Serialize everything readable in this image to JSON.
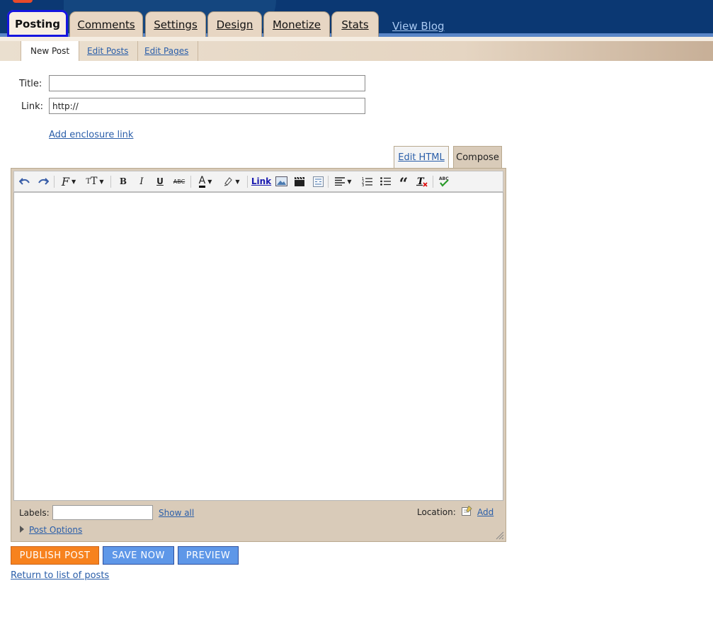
{
  "header": {
    "tabs": [
      {
        "label": "Posting",
        "active": true
      },
      {
        "label": "Comments"
      },
      {
        "label": "Settings"
      },
      {
        "label": "Design"
      },
      {
        "label": "Monetize"
      },
      {
        "label": "Stats"
      }
    ],
    "view_blog": "View Blog",
    "colors": {
      "header_bg": "#0b3873",
      "tab_bg": "#e7d6c3",
      "active_outline": "#1515e0"
    }
  },
  "subnav": {
    "items": [
      "New Post",
      "Edit Posts",
      "Edit Pages"
    ]
  },
  "form": {
    "title_label": "Title:",
    "title_value": "",
    "link_label": "Link:",
    "link_value": "http://",
    "enclosure_link": "Add enclosure link"
  },
  "editor": {
    "mode_tabs": {
      "edit_html": "Edit HTML",
      "compose": "Compose",
      "active": "Compose"
    },
    "toolbar": {
      "link_label": "Link",
      "icons": [
        "undo-icon",
        "redo-icon",
        "font-family-icon",
        "font-size-icon",
        "bold-icon",
        "italic-icon",
        "underline-icon",
        "strikethrough-icon",
        "text-color-icon",
        "highlight-color-icon",
        "link-icon",
        "insert-image-icon",
        "insert-video-icon",
        "jump-break-icon",
        "align-icon",
        "numbered-list-icon",
        "bullet-list-icon",
        "blockquote-icon",
        "remove-formatting-icon",
        "spellcheck-icon"
      ]
    },
    "body_value": "",
    "labels_label": "Labels:",
    "labels_value": "",
    "show_all": "Show all",
    "location_label": "Location:",
    "location_add": "Add",
    "post_options": "Post Options"
  },
  "actions": {
    "publish": "PUBLISH POST",
    "save": "SAVE NOW",
    "preview": "PREVIEW",
    "return_link": "Return to list of posts",
    "colors": {
      "publish": "#f7821e",
      "save": "#5e97e8",
      "preview": "#5e97e8"
    }
  }
}
